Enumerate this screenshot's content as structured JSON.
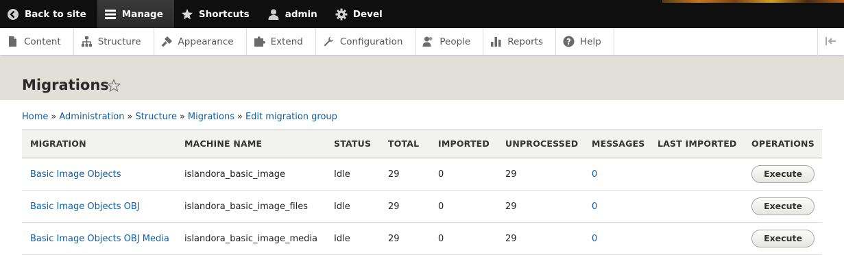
{
  "toolbar": {
    "back": "Back to site",
    "manage": "Manage",
    "shortcuts": "Shortcuts",
    "user": "admin",
    "devel": "Devel"
  },
  "tray": {
    "items": [
      {
        "label": "Content",
        "icon": "content-icon"
      },
      {
        "label": "Structure",
        "icon": "structure-icon"
      },
      {
        "label": "Appearance",
        "icon": "appearance-icon"
      },
      {
        "label": "Extend",
        "icon": "extend-icon"
      },
      {
        "label": "Configuration",
        "icon": "configuration-icon"
      },
      {
        "label": "People",
        "icon": "people-icon"
      },
      {
        "label": "Reports",
        "icon": "reports-icon"
      },
      {
        "label": "Help",
        "icon": "help-icon"
      }
    ]
  },
  "page": {
    "title": "Migrations"
  },
  "breadcrumb": [
    "Home",
    "Administration",
    "Structure",
    "Migrations",
    "Edit migration group"
  ],
  "breadcrumb_separator": "»",
  "table": {
    "headers": [
      "Migration",
      "Machine name",
      "Status",
      "Total",
      "Imported",
      "Unprocessed",
      "Messages",
      "Last imported",
      "Operations"
    ],
    "rows": [
      {
        "migration": "Basic Image Objects",
        "machine": "islandora_basic_image",
        "status": "Idle",
        "total": "29",
        "imported": "0",
        "unprocessed": "29",
        "messages": "0",
        "last": "",
        "op": "Execute"
      },
      {
        "migration": "Basic Image Objects OBJ",
        "machine": "islandora_basic_image_files",
        "status": "Idle",
        "total": "29",
        "imported": "0",
        "unprocessed": "29",
        "messages": "0",
        "last": "",
        "op": "Execute"
      },
      {
        "migration": "Basic Image Objects OBJ Media",
        "machine": "islandora_basic_image_media",
        "status": "Idle",
        "total": "29",
        "imported": "0",
        "unprocessed": "29",
        "messages": "0",
        "last": "",
        "op": "Execute"
      }
    ]
  },
  "colors": {
    "link": "#0a5fa8",
    "toolbar": "#0f0f0f",
    "header_band": "#e0e0d8"
  }
}
